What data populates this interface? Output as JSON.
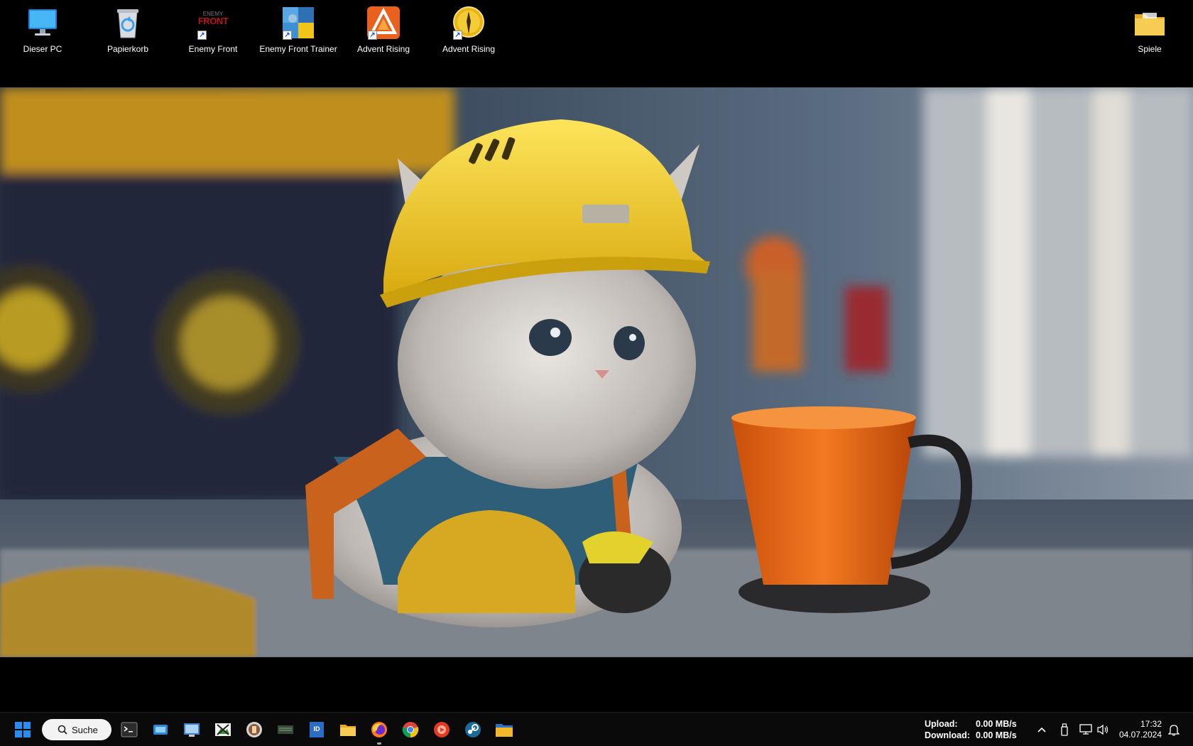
{
  "desktop": {
    "icons": [
      {
        "label": "Dieser PC"
      },
      {
        "label": "Papierkorb"
      },
      {
        "label": "Enemy Front",
        "logo_text": "FRONT"
      },
      {
        "label": "Enemy Front Trainer"
      },
      {
        "label": "Advent Rising"
      },
      {
        "label": "Advent Rising"
      },
      {
        "label": "Spiele"
      }
    ]
  },
  "taskbar": {
    "search_label": "Suche",
    "network": {
      "upload_label": "Upload:",
      "upload_value": "0.00 MB/s",
      "download_label": "Download:",
      "download_value": "0.00 MB/s"
    },
    "clock": {
      "time": "17:32",
      "date": "04.07.2024"
    }
  },
  "colors": {
    "taskbar_bg": "#0a0a0a",
    "windows_blue": "#2b8cf0",
    "helmet_yellow": "#f2cc1a",
    "mug_orange": "#e86a16"
  }
}
